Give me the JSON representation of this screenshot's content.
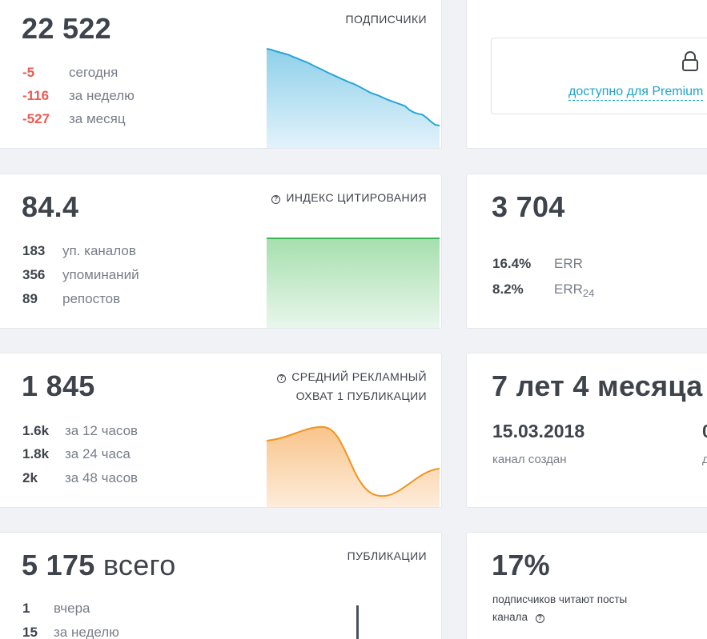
{
  "subscribers": {
    "value": "22 522",
    "title": "ПОДПИСЧИКИ",
    "stats": [
      {
        "value": "-5",
        "label": "сегодня"
      },
      {
        "value": "-116",
        "label": "за неделю"
      },
      {
        "value": "-527",
        "label": "за месяц"
      }
    ],
    "trend": [
      1.0,
      0.99,
      0.97,
      0.955,
      0.94,
      0.925,
      0.9,
      0.88,
      0.855,
      0.835,
      0.81,
      0.78,
      0.755,
      0.73,
      0.7,
      0.675,
      0.65,
      0.625,
      0.6,
      0.575,
      0.555,
      0.53,
      0.5,
      0.47,
      0.44,
      0.42,
      0.4,
      0.375,
      0.35,
      0.33,
      0.31,
      0.29,
      0.27,
      0.22,
      0.19,
      0.17,
      0.16,
      0.12,
      0.07,
      0.03,
      0.02
    ],
    "color": "#2aa5d6"
  },
  "premium": {
    "link_label": "доступно для Premium",
    "lock_icon": "lock-icon"
  },
  "citation": {
    "value": "84.4",
    "title": "ИНДЕКС ЦИТИРОВАНИЯ",
    "stats": [
      {
        "value": "183",
        "label": "уп. каналов"
      },
      {
        "value": "356",
        "label": "упоминаний"
      },
      {
        "value": "89",
        "label": "репостов"
      }
    ],
    "color": "#3fb55a"
  },
  "engagement": {
    "value": "3 704",
    "stats": [
      {
        "value": "16.4%",
        "label": "ERR",
        "sub": ""
      },
      {
        "value": "8.2%",
        "label": "ERR",
        "sub": "24"
      }
    ]
  },
  "ad_reach": {
    "value": "1 845",
    "title_line1": "СРЕДНИЙ РЕКЛАМНЫЙ",
    "title_line2": "ОХВАТ 1 ПУБЛИКАЦИИ",
    "stats": [
      {
        "value": "1.6k",
        "label": "за 12 часов"
      },
      {
        "value": "1.8k",
        "label": "за 24 часа"
      },
      {
        "value": "2k",
        "label": "за 48 часов"
      }
    ],
    "color": "#f3941f"
  },
  "age": {
    "value": "7 лет 4 месяца",
    "date": "15.03.2018",
    "date_label": "канал создан",
    "right_value_fragment": "0",
    "right_label_fragment": "д"
  },
  "publications": {
    "value": "5 175",
    "value_unit": "всего",
    "title": "ПУБЛИКАЦИИ",
    "stats": [
      {
        "value": "1",
        "label": "вчера"
      },
      {
        "value": "15",
        "label": "за неделю"
      }
    ]
  },
  "readers": {
    "value": "17%",
    "line1": "подписчиков читают посты",
    "line2": "канала"
  }
}
